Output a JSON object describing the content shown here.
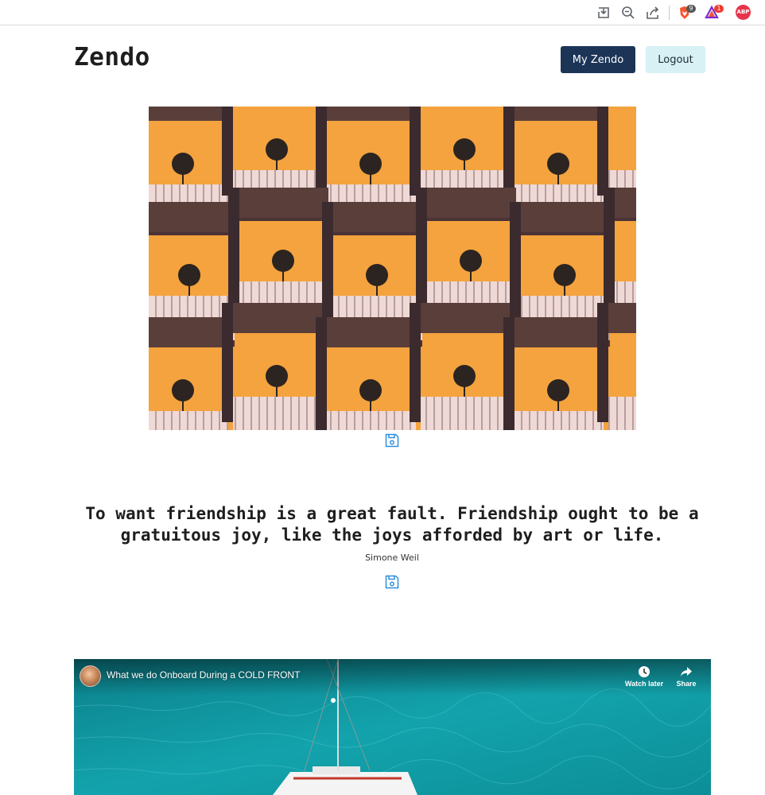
{
  "browser": {
    "icons": [
      "download-page-icon",
      "zoom-out-icon",
      "share-icon",
      "brave-shields-icon",
      "brave-rewards-icon",
      "adblock-plus-icon"
    ],
    "shields_count": "9",
    "rewards_count": "1",
    "abp_label": "ABP"
  },
  "header": {
    "brand": "Zendo",
    "my_zendo_label": "My Zendo",
    "logout_label": "Logout"
  },
  "colors": {
    "primary_button": "#1c3557",
    "secondary_button": "#d7f1f4",
    "save_icon": "#2f8fdc",
    "photo_orange": "#f7a23c",
    "video_water": "#0e8f97"
  },
  "feed": {
    "image_item": {
      "save_icon": "save-icon"
    },
    "quote_item": {
      "text": "To want friendship is a great fault. Friendship ought to be a gratuitous joy, like the joys afforded by art or life.",
      "author": "Simone Weil",
      "save_icon": "save-icon"
    },
    "video_item": {
      "title": "What we do Onboard During a COLD FRONT",
      "watch_later_label": "Watch later",
      "share_label": "Share"
    }
  }
}
